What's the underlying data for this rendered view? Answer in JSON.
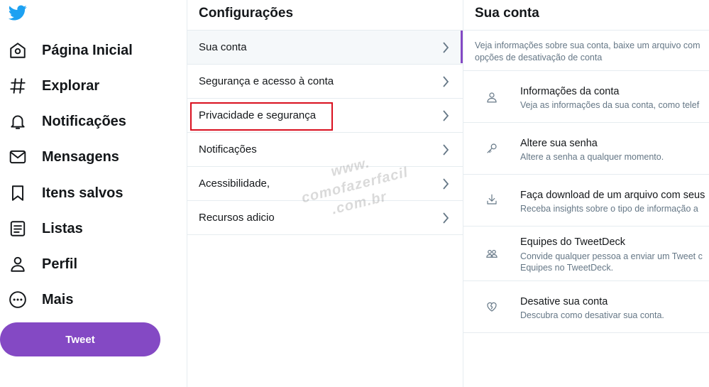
{
  "nav": {
    "logo_icon": "twitter-bird-icon",
    "items": [
      {
        "label": "Página Inicial",
        "icon": "home-icon"
      },
      {
        "label": "Explorar",
        "icon": "hashtag-icon"
      },
      {
        "label": "Notificações",
        "icon": "bell-icon"
      },
      {
        "label": "Mensagens",
        "icon": "envelope-icon"
      },
      {
        "label": "Itens salvos",
        "icon": "bookmark-icon"
      },
      {
        "label": "Listas",
        "icon": "list-icon"
      },
      {
        "label": "Perfil",
        "icon": "person-icon"
      },
      {
        "label": "Mais",
        "icon": "more-circle-icon"
      }
    ],
    "tweet_label": "Tweet",
    "accent_color": "#8449c4"
  },
  "settings": {
    "title": "Configurações",
    "items": [
      {
        "label": "Sua conta"
      },
      {
        "label": "Segurança e acesso à conta"
      },
      {
        "label": "Privacidade e segurança"
      },
      {
        "label": "Notificações"
      },
      {
        "label": "Acessibilidade,"
      },
      {
        "label": "Recursos adicio"
      }
    ],
    "highlight_color": "#d9101f"
  },
  "account": {
    "title": "Sua conta",
    "description_line1": "Veja informações sobre sua conta, baixe um arquivo com",
    "description_line2": "opções de desativação de conta",
    "items": [
      {
        "title": "Informações da conta",
        "sub1": "Veja as informações da sua conta, como telef",
        "sub2": "",
        "icon": "person-icon"
      },
      {
        "title": "Altere sua senha",
        "sub1": "Altere a senha a qualquer momento.",
        "sub2": "",
        "icon": "key-icon"
      },
      {
        "title": "Faça download de um arquivo com seus",
        "sub1": "Receba insights sobre o tipo de informação a",
        "sub2": "",
        "icon": "download-icon"
      },
      {
        "title": "Equipes do TweetDeck",
        "sub1": "Convide qualquer pessoa a enviar um Tweet c",
        "sub2": "Equipes no TweetDeck.",
        "icon": "people-icon"
      },
      {
        "title": "Desative sua conta",
        "sub1": "Descubra como desativar sua conta.",
        "sub2": "",
        "icon": "broken-heart-icon"
      }
    ]
  },
  "watermark": {
    "line1": "www.",
    "line2": "comofazerfacil",
    "line3": ".com.br"
  }
}
